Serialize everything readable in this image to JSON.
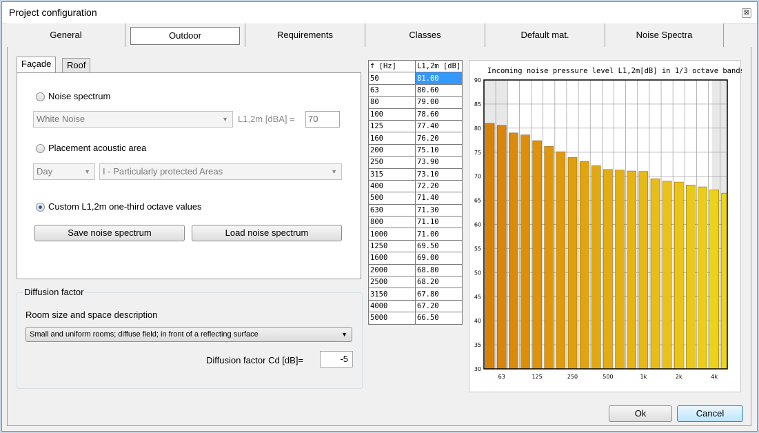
{
  "window": {
    "title": "Project configuration",
    "close_icon": "close-icon"
  },
  "tabs": [
    {
      "label": "General"
    },
    {
      "label": "Outdoor"
    },
    {
      "label": "Requirements"
    },
    {
      "label": "Classes"
    },
    {
      "label": "Default mat."
    },
    {
      "label": "Noise Spectra"
    }
  ],
  "subtabs": {
    "facade": "Façade",
    "roof": "Roof"
  },
  "facade": {
    "noise_spectrum_label": "Noise spectrum",
    "spectrum_combo_value": "White Noise",
    "level_label": "L1,2m [dBA] =",
    "level_value": "70",
    "placement_label": "Placement acoustic area",
    "period_value": "Day",
    "area_value": "I - Particularly protected Areas",
    "custom_label": "Custom L1,2m one-third octave values",
    "save_button": "Save noise spectrum",
    "load_button": "Load noise spectrum"
  },
  "diffusion": {
    "group_title": "Diffusion factor",
    "room_label": "Room size and space description",
    "room_value": "Small and uniform rooms; diffuse field; in front of a reflecting surface",
    "cd_label": "Diffusion factor Cd [dB]=",
    "cd_value": "-5"
  },
  "table": {
    "headers": [
      "f [Hz]",
      "L1,2m [dB]"
    ],
    "rows": [
      [
        "50",
        "81.00"
      ],
      [
        "63",
        "80.60"
      ],
      [
        "80",
        "79.00"
      ],
      [
        "100",
        "78.60"
      ],
      [
        "125",
        "77.40"
      ],
      [
        "160",
        "76.20"
      ],
      [
        "200",
        "75.10"
      ],
      [
        "250",
        "73.90"
      ],
      [
        "315",
        "73.10"
      ],
      [
        "400",
        "72.20"
      ],
      [
        "500",
        "71.40"
      ],
      [
        "630",
        "71.30"
      ],
      [
        "800",
        "71.10"
      ],
      [
        "1000",
        "71.00"
      ],
      [
        "1250",
        "69.50"
      ],
      [
        "1600",
        "69.00"
      ],
      [
        "2000",
        "68.80"
      ],
      [
        "2500",
        "68.20"
      ],
      [
        "3150",
        "67.80"
      ],
      [
        "4000",
        "67.20"
      ],
      [
        "5000",
        "66.50"
      ]
    ]
  },
  "chart_data": {
    "type": "bar",
    "title": "Incoming noise pressure level L1,2m[dB] in 1/3 octave bands",
    "xlabel": "",
    "ylabel": "",
    "ylim": [
      30,
      90
    ],
    "yticks": [
      30,
      35,
      40,
      45,
      50,
      55,
      60,
      65,
      70,
      75,
      80,
      85,
      90
    ],
    "xtick_labels": [
      "63",
      "125",
      "250",
      "500",
      "1k",
      "2k",
      "4k"
    ],
    "xtick_band_index": [
      1,
      4,
      7,
      10,
      13,
      16,
      19
    ],
    "categories": [
      "50",
      "63",
      "80",
      "100",
      "125",
      "160",
      "200",
      "250",
      "315",
      "400",
      "500",
      "630",
      "800",
      "1000",
      "1250",
      "1600",
      "2000",
      "2500",
      "3150",
      "4000",
      "5000"
    ],
    "values": [
      81.0,
      80.6,
      79.0,
      78.6,
      77.4,
      76.2,
      75.1,
      73.9,
      73.1,
      72.2,
      71.4,
      71.3,
      71.1,
      71.0,
      69.5,
      69.0,
      68.8,
      68.2,
      67.8,
      67.2,
      66.5
    ],
    "bar_color_start": "#d9820a",
    "bar_color_end": "#eed61c",
    "grid": true
  },
  "footer": {
    "ok": "Ok",
    "cancel": "Cancel"
  }
}
